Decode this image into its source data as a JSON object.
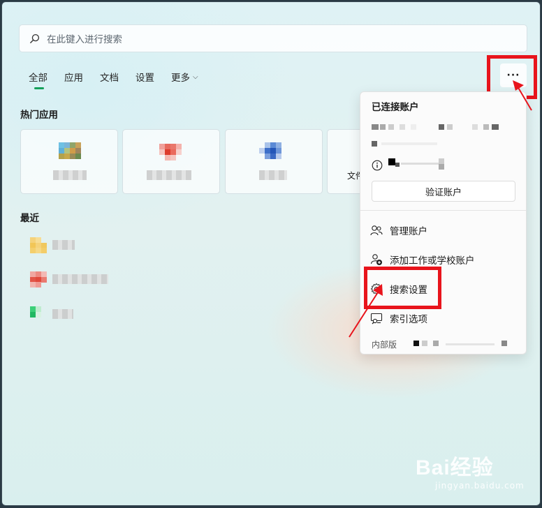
{
  "search": {
    "placeholder": "在此键入进行搜索",
    "icon": "search-icon"
  },
  "tabs": [
    {
      "label": "全部",
      "active": true
    },
    {
      "label": "应用"
    },
    {
      "label": "文档"
    },
    {
      "label": "设置"
    },
    {
      "label": "更多",
      "has_dropdown": true
    }
  ],
  "more_button": {
    "label": "···"
  },
  "hot_apps": {
    "title": "热门应用",
    "partial_label": "文件"
  },
  "recent": {
    "title": "最近"
  },
  "menu": {
    "title": "已连接账户",
    "verify_button": "验证账户",
    "items": [
      {
        "label": "管理账户",
        "icon": "people-icon"
      },
      {
        "label": "添加工作或学校账户",
        "icon": "add-account-icon"
      },
      {
        "label": "搜索设置",
        "icon": "gear-icon"
      },
      {
        "label": "索引选项",
        "icon": "index-icon"
      }
    ],
    "footer": "内部版"
  },
  "watermark": {
    "brand": "Bai经验",
    "url": "jingyan.baidu.com"
  },
  "colors": {
    "accent": "#15a05a",
    "highlight": "#e8141c"
  }
}
